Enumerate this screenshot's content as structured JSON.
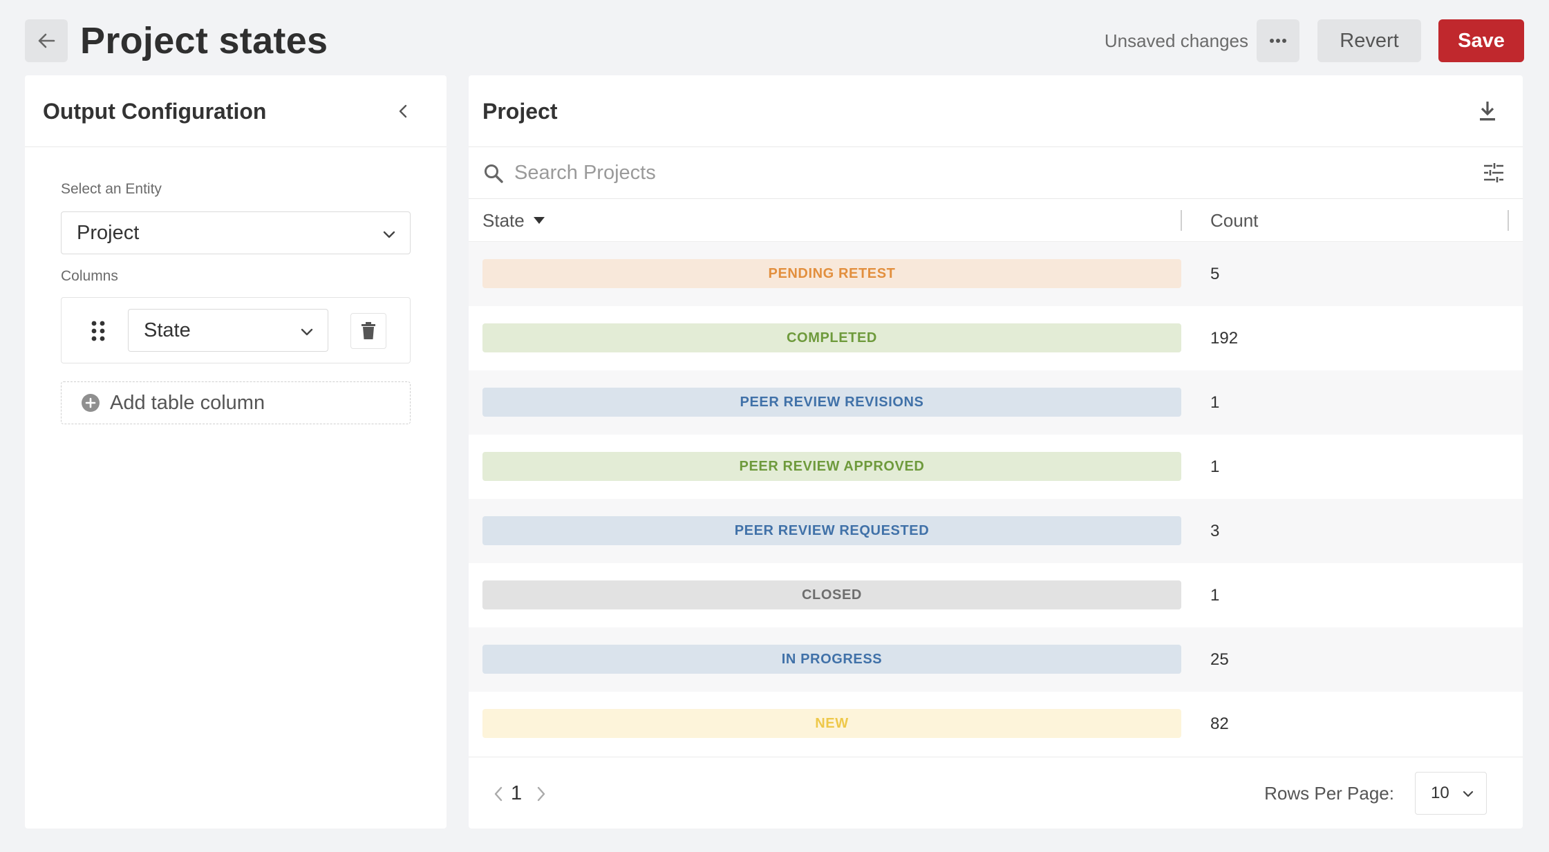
{
  "header": {
    "title": "Project states",
    "unsaved_text": "Unsaved changes",
    "revert_label": "Revert",
    "save_label": "Save"
  },
  "left_panel": {
    "title": "Output Configuration",
    "entity_label": "Select an Entity",
    "entity_value": "Project",
    "columns_label": "Columns",
    "columns": [
      {
        "value": "State"
      }
    ],
    "add_column_label": "Add table column"
  },
  "right_panel": {
    "title": "Project",
    "search_placeholder": "Search Projects",
    "table": {
      "headers": {
        "state": "State",
        "count": "Count"
      },
      "rows": [
        {
          "state": "PENDING RETEST",
          "count": "5",
          "color": "#e28f3e",
          "bg": "#f8e8da"
        },
        {
          "state": "COMPLETED",
          "count": "192",
          "color": "#6e9a3c",
          "bg": "#e3ecd6"
        },
        {
          "state": "PEER REVIEW REVISIONS",
          "count": "1",
          "color": "#4071a8",
          "bg": "#dae3ec"
        },
        {
          "state": "PEER REVIEW APPROVED",
          "count": "1",
          "color": "#6e9a3c",
          "bg": "#e3ecd6"
        },
        {
          "state": "PEER REVIEW REQUESTED",
          "count": "3",
          "color": "#4071a8",
          "bg": "#dae3ec"
        },
        {
          "state": "CLOSED",
          "count": "1",
          "color": "#6e6e6e",
          "bg": "#e2e2e2"
        },
        {
          "state": "IN PROGRESS",
          "count": "25",
          "color": "#4071a8",
          "bg": "#dae3ec"
        },
        {
          "state": "NEW",
          "count": "82",
          "color": "#eec84a",
          "bg": "#fdf4da"
        }
      ]
    },
    "pagination": {
      "current_page": "1",
      "rows_per_page_label": "Rows Per Page:",
      "rows_per_page_value": "10"
    }
  },
  "colors": {
    "primary": "#c0282d",
    "background": "#f2f3f5"
  },
  "icons": [
    "arrow-left-icon",
    "more-horizontal-icon",
    "chevron-left-icon",
    "chevron-down-icon",
    "drag-handle-icon",
    "trash-icon",
    "plus-circle-icon",
    "download-icon",
    "search-icon",
    "filter-sliders-icon",
    "caret-down-icon",
    "chevron-right-icon"
  ]
}
